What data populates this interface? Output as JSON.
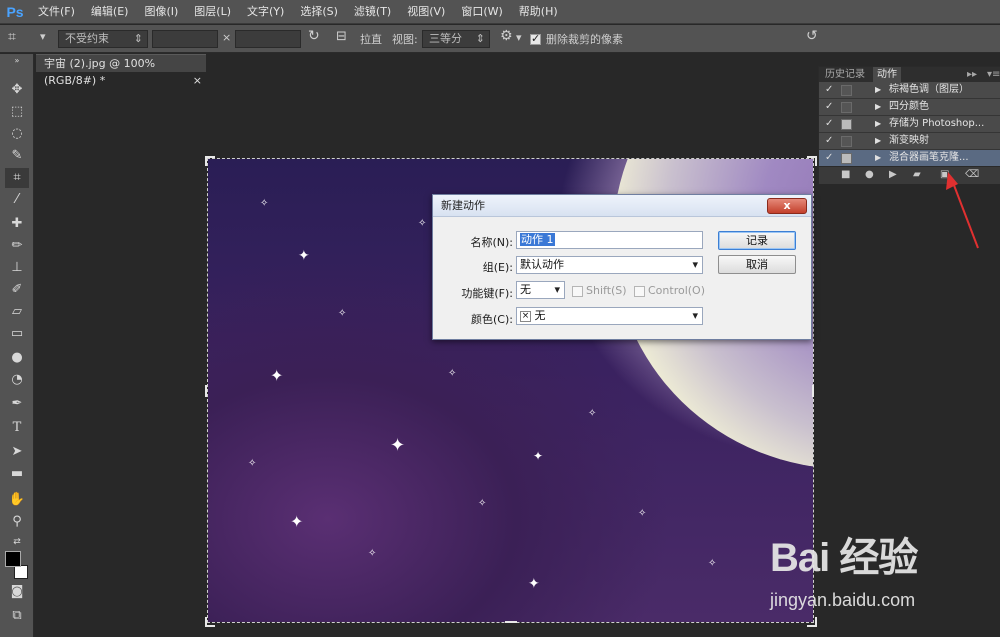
{
  "app": {
    "logo": "Ps"
  },
  "menu": [
    "文件(F)",
    "编辑(E)",
    "图像(I)",
    "图层(L)",
    "文字(Y)",
    "选择(S)",
    "滤镜(T)",
    "视图(V)",
    "窗口(W)",
    "帮助(H)"
  ],
  "options": {
    "ratio_preset": "不受约束",
    "width_value": "",
    "height_value": "",
    "straighten_label": "拉直",
    "view_label": "视图:",
    "view_value": "三等分",
    "delete_cropped_label": "删除裁剪的像素",
    "delete_cropped_checked": true
  },
  "document": {
    "tab_title": "宇宙 (2).jpg @ 100%(RGB/8#) *",
    "close_glyph": "×"
  },
  "panel": {
    "tabs": [
      "历史记录",
      "动作"
    ],
    "active_tab": "动作",
    "actions": [
      {
        "check": "✓",
        "label": "棕褐色调（图层）",
        "selected": false
      },
      {
        "check": "✓",
        "label": "四分颜色",
        "selected": false
      },
      {
        "check": "✓",
        "label": "存储为 Photoshop...",
        "selected": false
      },
      {
        "check": "✓",
        "label": "渐变映射",
        "selected": false
      },
      {
        "check": "✓",
        "label": "混合器画笔克隆...",
        "selected": true
      }
    ]
  },
  "dialog": {
    "title": "新建动作",
    "close_label": "x",
    "name_label": "名称(N):",
    "name_value": "动作 1",
    "set_label": "组(E):",
    "set_value": "默认动作",
    "fkey_label": "功能键(F):",
    "fkey_value": "无",
    "shift_label": "Shift(S)",
    "control_label": "Control(O)",
    "color_label": "颜色(C):",
    "color_value": "无",
    "color_icon": "×",
    "record_button": "记录",
    "cancel_button": "取消"
  },
  "watermark": {
    "logo": "Bai 经验",
    "url": "jingyan.baidu.com"
  },
  "colors": {
    "accent": "#3a78d6",
    "arrow": "#e03030",
    "panel_selected": "#5a6a82"
  }
}
